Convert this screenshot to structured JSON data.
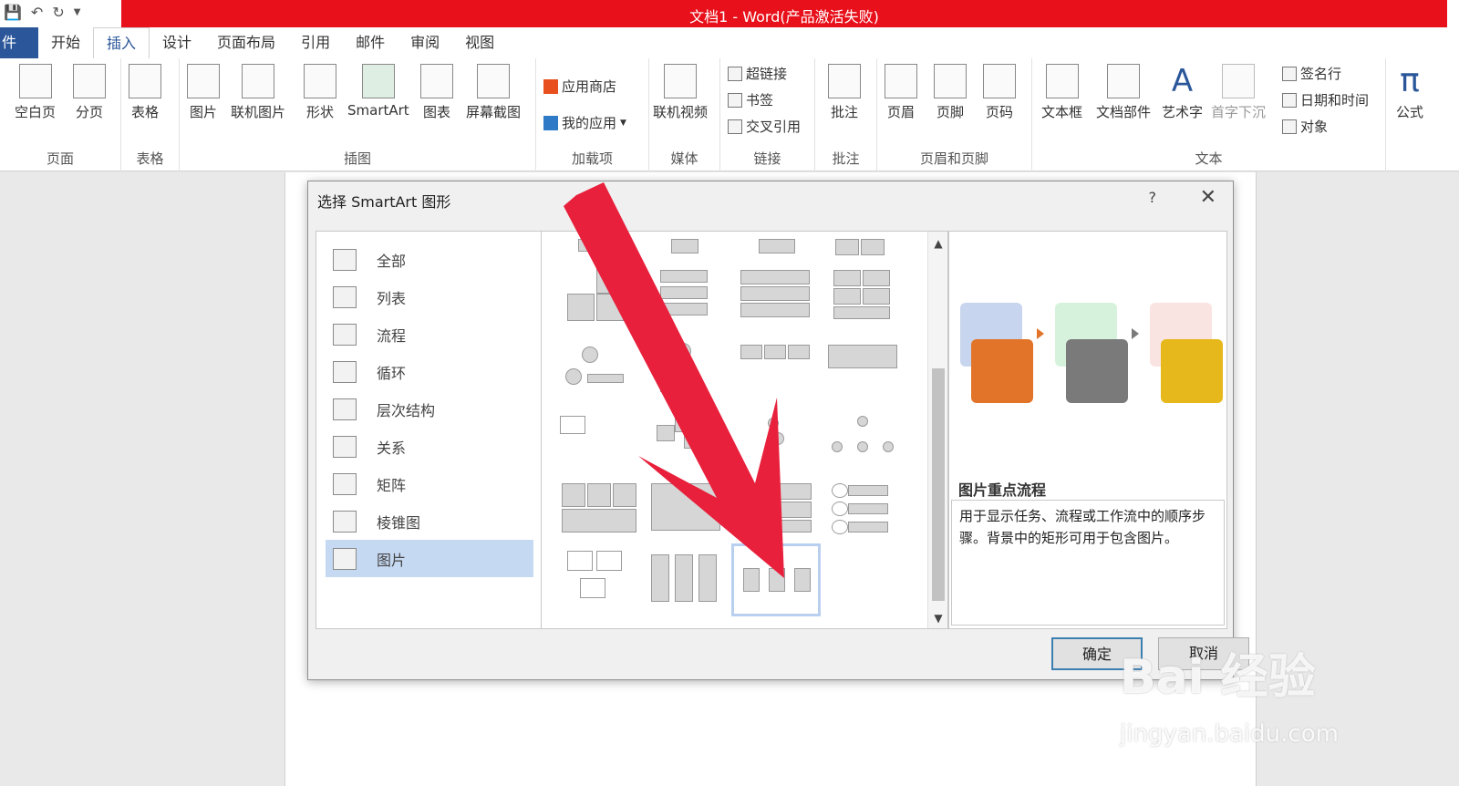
{
  "window": {
    "title": "文档1 -  Word(产品激活失败)"
  },
  "tabs": [
    {
      "label": "件"
    },
    {
      "label": "开始"
    },
    {
      "label": "插入"
    },
    {
      "label": "设计"
    },
    {
      "label": "页面布局"
    },
    {
      "label": "引用"
    },
    {
      "label": "邮件"
    },
    {
      "label": "审阅"
    },
    {
      "label": "视图"
    }
  ],
  "ribbon": {
    "groups": {
      "pages": "页面",
      "tables": "表格",
      "illustrations": "插图",
      "addins": "加载项",
      "media": "媒体",
      "links": "链接",
      "comments": "批注",
      "header_footer": "页眉和页脚",
      "text": "文本"
    },
    "buttons": {
      "blank_page": "空白页",
      "page_break": "分页",
      "table": "表格",
      "picture": "图片",
      "online_picture": "联机图片",
      "shapes": "形状",
      "smartart": "SmartArt",
      "chart": "图表",
      "screenshot": "屏幕截图",
      "store": "应用商店",
      "my_apps": "我的应用",
      "online_video": "联机视频",
      "hyperlink": "超链接",
      "bookmark": "书签",
      "cross_ref": "交叉引用",
      "comment": "批注",
      "header": "页眉",
      "footer": "页脚",
      "page_number": "页码",
      "textbox": "文本框",
      "quick_parts": "文档部件",
      "wordart": "艺术字",
      "dropcap": "首字下沉",
      "signature": "签名行",
      "datetime": "日期和时间",
      "object": "对象",
      "equation": "公式"
    }
  },
  "dialog": {
    "title": "选择 SmartArt 图形",
    "help": "?",
    "categories": [
      "全部",
      "列表",
      "流程",
      "循环",
      "层次结构",
      "关系",
      "矩阵",
      "棱锥图",
      "图片"
    ],
    "selected_category": "图片",
    "preview_name": "图片重点流程",
    "preview_desc": "用于显示任务、流程或工作流中的顺序步骤。背景中的矩形可用于包含图片。",
    "ok": "确定",
    "cancel": "取消"
  },
  "watermark": {
    "brand": "Bai 经验",
    "url": "jingyan.baidu.com"
  },
  "colors": {
    "title_red": "#e8101a",
    "file_tab": "#2b579a",
    "arrow": "#e8203c",
    "selection": "#c6d9f3"
  }
}
